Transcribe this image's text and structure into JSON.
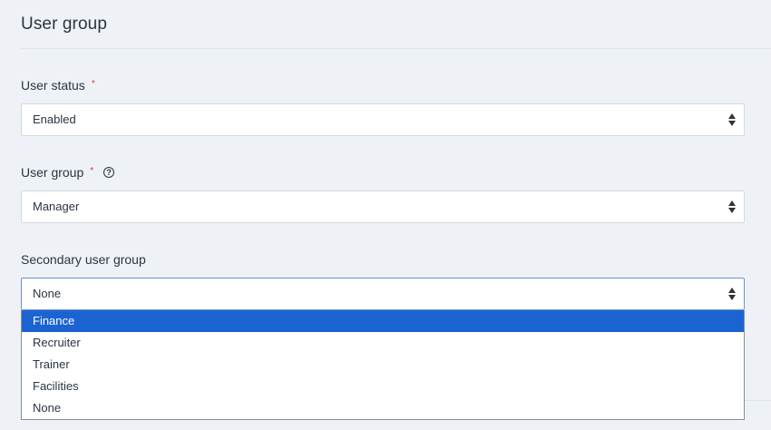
{
  "section": {
    "title": "User group"
  },
  "fields": {
    "user_status": {
      "label": "User status",
      "required_mark": "*",
      "value": "Enabled"
    },
    "user_group": {
      "label": "User group",
      "required_mark": "*",
      "help_icon": "question-circle-icon",
      "help_glyph": "?",
      "value": "Manager"
    },
    "secondary_user_group": {
      "label": "Secondary user group",
      "value": "None",
      "dropdown_open": true,
      "options": [
        "Finance",
        "Recruiter",
        "Trainer",
        "Facilities",
        "None"
      ],
      "highlighted_option": "Finance"
    }
  },
  "colors": {
    "background": "#eef2f6",
    "required": "#e0353a",
    "highlight": "#1b63d2",
    "focus_border": "#6f93c7"
  }
}
